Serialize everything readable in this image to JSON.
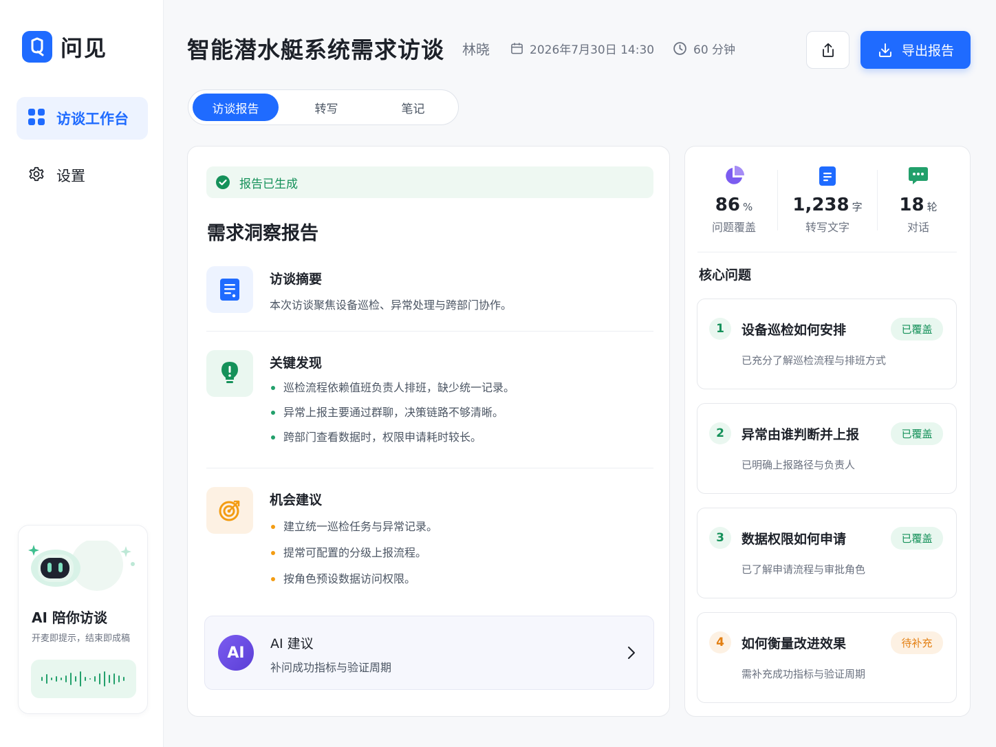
{
  "app": {
    "name": "问见",
    "brand_color": "#1f6bff"
  },
  "sidebar": {
    "items": [
      {
        "label": "访谈工作台",
        "icon": "grid-icon",
        "active": true
      },
      {
        "label": "设置",
        "icon": "gear-icon",
        "active": false
      }
    ],
    "ai_card": {
      "title": "AI 陪你访谈",
      "subtitle": "开麦即提示，结束即成稿",
      "icon": "robot-icon"
    }
  },
  "header": {
    "title": "智能潜水艇系统需求访谈",
    "author": "林晓",
    "datetime": "2026年7月30日 14:30",
    "duration": "60 分钟",
    "export_label": "导出报告"
  },
  "tabs": [
    {
      "label": "访谈报告",
      "active": true
    },
    {
      "label": "转写",
      "active": false
    },
    {
      "label": "笔记",
      "active": false
    }
  ],
  "report": {
    "status": "报告已生成",
    "title": "需求洞察报告",
    "summary": {
      "title": "访谈摘要",
      "text": "本次访谈聚焦设备巡检、异常处理与跨部门协作。"
    },
    "findings": {
      "title": "关键发现",
      "items": [
        "巡检流程依赖值班负责人排班，缺少统一记录。",
        "异常上报主要通过群聊，决策链路不够清晰。",
        "跨部门查看数据时，权限申请耗时较长。"
      ]
    },
    "opportunities": {
      "title": "机会建议",
      "items": [
        "建立统一巡检任务与异常记录。",
        "提常可配置的分级上报流程。",
        "按角色预设数据访问权限。"
      ]
    },
    "ai_suggestion": {
      "avatar": "AI",
      "title": "AI 建议",
      "subtitle": "补问成功指标与验证周期"
    }
  },
  "stats": [
    {
      "value": "86",
      "unit": "%",
      "label": "问题覆盖",
      "icon": "pie-chart-icon",
      "color": "#7b5cf0"
    },
    {
      "value": "1,238",
      "unit": "字",
      "label": "转写文字",
      "icon": "document-icon",
      "color": "#1f6bff"
    },
    {
      "value": "18",
      "unit": "轮",
      "label": "对话",
      "icon": "chat-icon",
      "color": "#22a06b"
    }
  ],
  "core_questions": {
    "title": "核心问题",
    "items": [
      {
        "num": "1",
        "title": "设备巡检如何安排",
        "sub": "已充分了解巡检流程与排班方式",
        "badge": "已覆盖",
        "state": "covered"
      },
      {
        "num": "2",
        "title": "异常由谁判断并上报",
        "sub": "已明确上报路径与负责人",
        "badge": "已覆盖",
        "state": "covered"
      },
      {
        "num": "3",
        "title": "数据权限如何申请",
        "sub": "已了解申请流程与审批角色",
        "badge": "已覆盖",
        "state": "covered"
      },
      {
        "num": "4",
        "title": "如何衡量改进效果",
        "sub": "需补充成功指标与验证周期",
        "badge": "待补充",
        "state": "pending"
      }
    ]
  }
}
